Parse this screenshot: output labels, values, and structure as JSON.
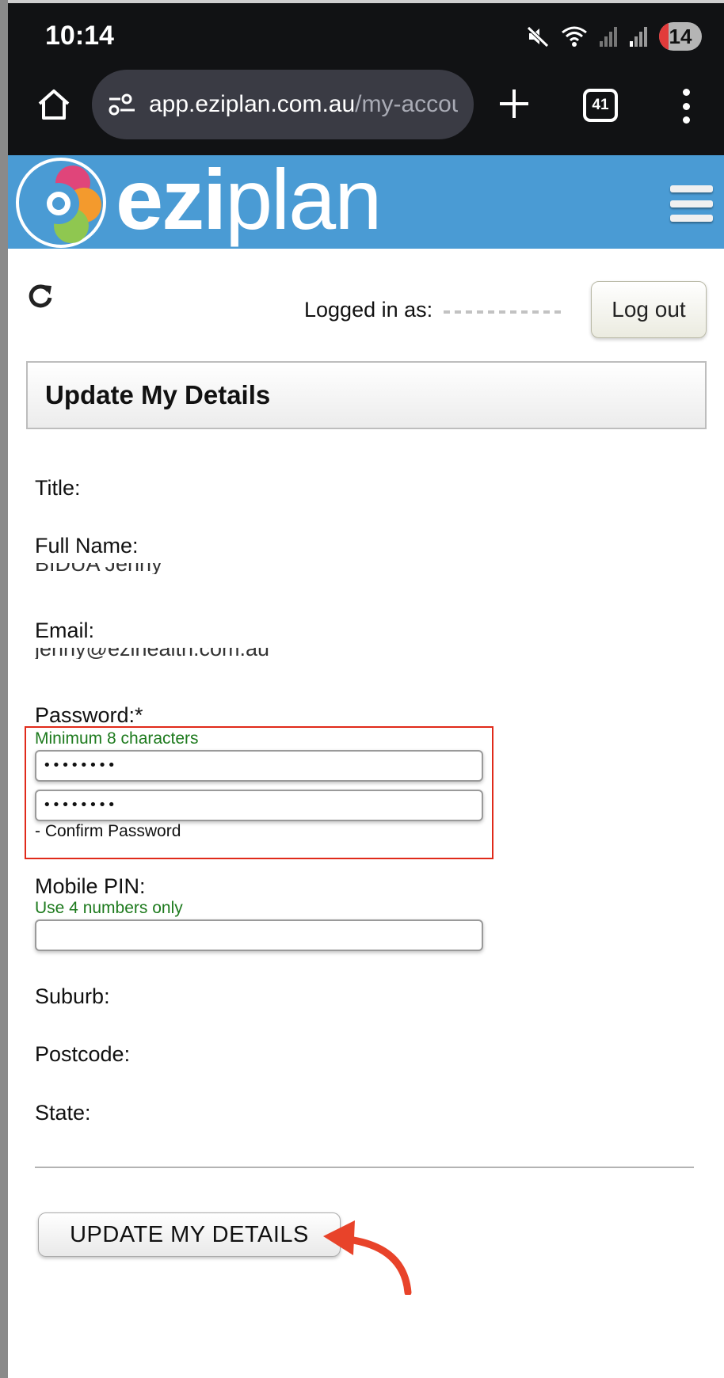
{
  "status_bar": {
    "time": "10:14",
    "notification_count": "14"
  },
  "browser": {
    "url_host": "app.eziplan.com.au",
    "url_path": "/my-accou",
    "tab_count": "41"
  },
  "site": {
    "logo_text_bold": "ezi",
    "logo_text_light": "plan",
    "colors": {
      "header_bg": "#4a9bd4",
      "hint_green": "#1d7a1d",
      "highlight_red": "#e02a1a",
      "arrow_red": "#e8432a"
    }
  },
  "account": {
    "logged_in_label": "Logged in as:",
    "logout_label": "Log out"
  },
  "form": {
    "title": "Update My Details",
    "title_label": "Title:",
    "full_name_label": "Full Name:",
    "email_label": "Email:",
    "password_label": "Password:*",
    "password_hint": "Minimum 8 characters",
    "password_value": "••••••••",
    "confirm_value": "••••••••",
    "confirm_note": "- Confirm Password",
    "pin_label": "Mobile PIN:",
    "pin_hint": "Use 4 numbers only",
    "pin_value": "",
    "suburb_label": "Suburb:",
    "postcode_label": "Postcode:",
    "state_label": "State:",
    "submit_label": "UPDATE MY DETAILS"
  }
}
